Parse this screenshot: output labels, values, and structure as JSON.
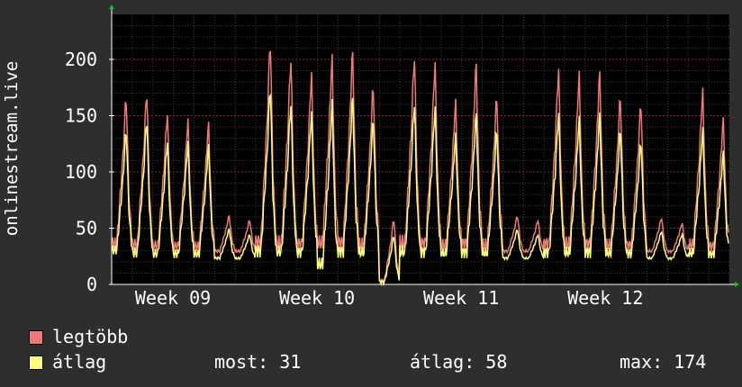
{
  "chart_data": {
    "type": "line",
    "ylabel": "onlinestream.live",
    "ylim": [
      0,
      240
    ],
    "yticks": [
      0,
      50,
      100,
      150,
      200
    ],
    "xticks": [
      "Week 09",
      "Week 10",
      "Week 11",
      "Week 12"
    ],
    "grid": true,
    "colors": {
      "background": "#000000",
      "frame": "#2e2e2e",
      "grid_minor": "#3a3a3a",
      "grid_major": "#7a3030",
      "max_series": "#f07878",
      "avg_series": "#ffff80"
    },
    "days": 30,
    "series": [
      {
        "name": "legtöbb",
        "daily_peaks": [
          170,
          175,
          155,
          148,
          145,
          62,
          58,
          222,
          205,
          190,
          205,
          212,
          180,
          60,
          208,
          200,
          165,
          200,
          170,
          62,
          58,
          195,
          190,
          192,
          170,
          165,
          60,
          55,
          175,
          150
        ],
        "daily_lows": [
          30,
          28,
          28,
          28,
          28,
          28,
          28,
          28,
          28,
          28,
          28,
          28,
          28,
          0,
          28,
          28,
          28,
          28,
          28,
          28,
          28,
          28,
          28,
          28,
          28,
          28,
          28,
          28,
          28,
          28
        ]
      },
      {
        "name": "átlag",
        "daily_peaks": [
          140,
          150,
          130,
          128,
          125,
          50,
          45,
          180,
          165,
          155,
          165,
          170,
          150,
          45,
          165,
          160,
          135,
          155,
          140,
          50,
          45,
          155,
          150,
          155,
          140,
          130,
          48,
          45,
          140,
          120
        ],
        "daily_lows": [
          25,
          22,
          22,
          22,
          22,
          22,
          22,
          22,
          22,
          22,
          10,
          22,
          22,
          0,
          22,
          22,
          22,
          22,
          22,
          22,
          22,
          22,
          22,
          22,
          22,
          22,
          22,
          22,
          22,
          22
        ]
      }
    ]
  },
  "legend": {
    "max_label": "legtöbb",
    "avg_label": "átlag",
    "now_text": "most: 31",
    "avg_text": "átlag: 58",
    "max_text": "max: 174"
  }
}
